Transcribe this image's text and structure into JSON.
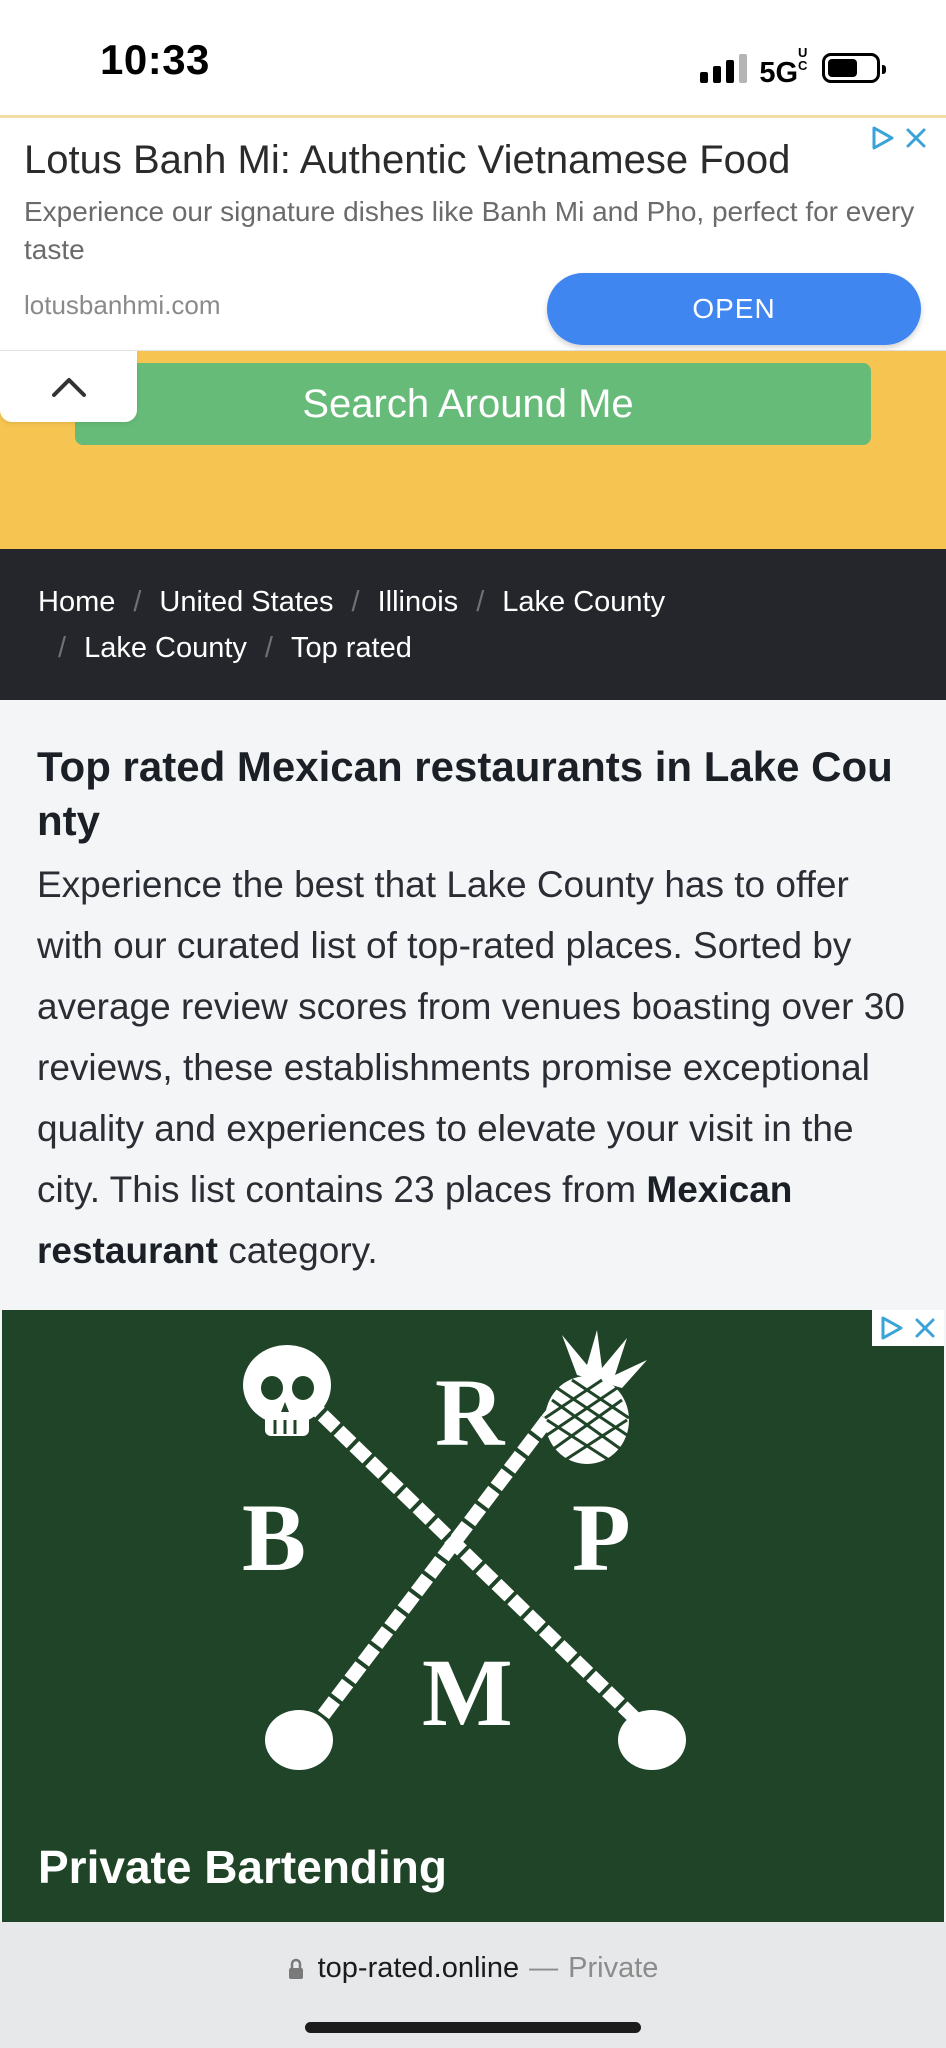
{
  "status_bar": {
    "time": "10:33",
    "network": "5G",
    "network_suffix": "UC",
    "battery_level": 0.64,
    "signal_bars_filled": 3,
    "signal_bars_total": 4
  },
  "ad_top": {
    "title": "Lotus Banh Mi: Authentic Vietnamese Food",
    "description": "Experience our signature dishes like Banh Mi and Pho, perfect for every taste",
    "domain": "lotusbanhmi.com",
    "cta": "OPEN",
    "cta_color": "#3f86f0",
    "icons": [
      "adchoices-icon",
      "close-icon"
    ]
  },
  "hero": {
    "search_button": "Search Around Me",
    "background_color": "#f6c451",
    "button_color": "#66bb79",
    "collapse_icon": "chevron-up-icon"
  },
  "breadcrumb": {
    "items": [
      "Home",
      "United States",
      "Illinois",
      "Lake County",
      "Lake County",
      "Top rated"
    ],
    "separator": "/"
  },
  "main": {
    "title": "Top rated Mexican restaurants in Lake County",
    "intro_text": "Experience the best that Lake County has to offer with our curated list of top-rated places. Sorted by average review scores from venues boasting over 30 reviews, these establishments promise exceptional quality and experiences to elevate your visit in the city. This list contains 23 places from ",
    "intro_category": "Mexican restaurant",
    "intro_suffix": " category."
  },
  "ad_bartending": {
    "logo_letters": [
      "R",
      "B",
      "P",
      "M"
    ],
    "title": "Private Bartending",
    "background_color": "#1f4428",
    "icons": [
      "adchoices-icon",
      "close-icon"
    ]
  },
  "browser_bar": {
    "url": "top-rated.online",
    "dash": "—",
    "mode": "Private",
    "lock_icon": "lock-icon"
  }
}
